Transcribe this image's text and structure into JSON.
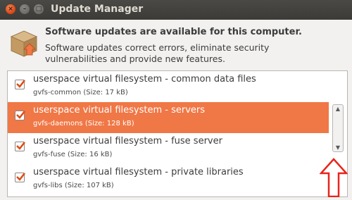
{
  "window": {
    "title": "Update Manager",
    "close_glyph": "×",
    "minimize_glyph": "–",
    "maximize_glyph": "□"
  },
  "header": {
    "icon": "package-update-icon",
    "title": "Software updates are available for this computer.",
    "description": "Software updates correct errors, eliminate security vulnerabilities and provide new features."
  },
  "updates": [
    {
      "name": "userspace virtual filesystem - common data files",
      "package": "gvfs-common (Size: 17 kB)",
      "checked": true,
      "selected": false
    },
    {
      "name": "userspace virtual filesystem - servers",
      "package": "gvfs-daemons (Size: 128 kB)",
      "checked": true,
      "selected": true
    },
    {
      "name": "userspace virtual filesystem - fuse server",
      "package": "gvfs-fuse (Size: 16 kB)",
      "checked": true,
      "selected": false
    },
    {
      "name": "userspace virtual filesystem - private libraries",
      "package": "gvfs-libs (Size: 107 kB)",
      "checked": true,
      "selected": false
    }
  ],
  "scrollbar": {
    "up_glyph": "▲",
    "down_glyph": "▼"
  },
  "colors": {
    "selection": "#f07746",
    "checkmark": "#df4a16",
    "annotation_arrow": "#e8251c"
  }
}
